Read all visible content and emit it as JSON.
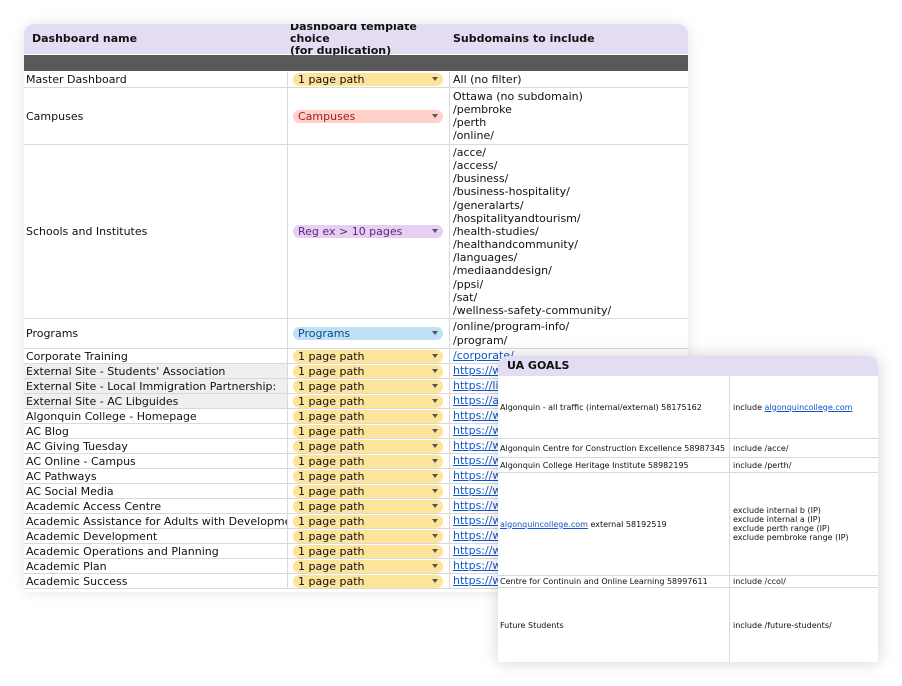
{
  "headers": {
    "name": "Dashboard name",
    "template_line1": "Dashboard template choice",
    "template_line2": "(for duplication)",
    "subdomains": "Subdomains to include"
  },
  "colors": {
    "yellow_chip": "#fde49b",
    "red_chip": "#ffcfc9",
    "purple_chip": "#e6cff2",
    "blue_chip": "#bfe1f6",
    "header_bg": "#e3dcf3",
    "link": "#1155cc"
  },
  "rows": [
    {
      "name": "Master Dashboard",
      "choice": "1 page path",
      "chip": "yellow",
      "subs": [
        "All (no filter)"
      ],
      "link": false,
      "gray": false
    },
    {
      "name": "Campuses",
      "choice": "Campuses",
      "chip": "red",
      "subs": [
        "Ottawa (no subdomain)",
        "/pembroke",
        "/perth",
        "/online/"
      ],
      "link": false,
      "gray": false
    },
    {
      "name": "Schools and Institutes",
      "choice": "Reg ex > 10 pages",
      "chip": "purple",
      "subs": [
        "/acce/",
        "/access/",
        "/business/",
        "/business-hospitality/",
        "/generalarts/",
        "/hospitalityandtourism/",
        "/health-studies/",
        "/healthandcommunity/",
        "/languages/",
        "/mediaanddesign/",
        "/ppsi/",
        "/sat/",
        "/wellness-safety-community/"
      ],
      "link": false,
      "gray": false
    },
    {
      "name": "Programs",
      "choice": "Programs",
      "chip": "blue",
      "subs": [
        "/online/program-info/",
        "/program/"
      ],
      "link": false,
      "gray": false
    },
    {
      "name": "Corporate Training",
      "choice": "1 page path",
      "chip": "yellow",
      "subs": [
        "/corporate/"
      ],
      "link": true,
      "gray": false
    },
    {
      "name": "External Site - Students' Association",
      "choice": "1 page path",
      "chip": "yellow",
      "subs": [
        "https://www.algonquinsa.com/"
      ],
      "link": true,
      "gray": true
    },
    {
      "name": "External Site - Local Immigration Partnership:",
      "choice": "1 page path",
      "chip": "yellow",
      "subs": [
        "https://lip.algonquincollege.com/"
      ],
      "link": true,
      "gray": true
    },
    {
      "name": "External Site - AC Libguides",
      "choice": "1 page path",
      "chip": "yellow",
      "subs": [
        "https://algonquincollege.libguides.com/"
      ],
      "link": true,
      "gray": true
    },
    {
      "name": "Algonquin College - Homepage",
      "choice": "1 page path",
      "chip": "yellow",
      "subs": [
        "https://www.algonquincollege.com/"
      ],
      "link": true,
      "gray": false
    },
    {
      "name": "AC Blog",
      "choice": "1 page path",
      "chip": "yellow",
      "subs": [
        "https://www.algonquincollege.com/"
      ],
      "link": true,
      "gray": false
    },
    {
      "name": "AC Giving Tuesday",
      "choice": "1 page path",
      "chip": "yellow",
      "subs": [
        "https://www.algonquincollege.com/"
      ],
      "link": true,
      "gray": false
    },
    {
      "name": "AC Online - Campus",
      "choice": "1 page path",
      "chip": "yellow",
      "subs": [
        "https://www.algonquincollege.com/"
      ],
      "link": true,
      "gray": false
    },
    {
      "name": "AC Pathways",
      "choice": "1 page path",
      "chip": "yellow",
      "subs": [
        "https://www.algonquincollege.com/"
      ],
      "link": true,
      "gray": false
    },
    {
      "name": "AC Social Media",
      "choice": "1 page path",
      "chip": "yellow",
      "subs": [
        "https://www.algonquincollege.com/"
      ],
      "link": true,
      "gray": false
    },
    {
      "name": "Academic Access Centre",
      "choice": "1 page path",
      "chip": "yellow",
      "subs": [
        "https://www.algonquincollege.com/"
      ],
      "link": true,
      "gray": false
    },
    {
      "name": "Academic Assistance for Adults with Development",
      "choice": "1 page path",
      "chip": "yellow",
      "subs": [
        "https://www.algonquincollege.com/"
      ],
      "link": true,
      "gray": false
    },
    {
      "name": "Academic Development",
      "choice": "1 page path",
      "chip": "yellow",
      "subs": [
        "https://www.algonquincollege.com/"
      ],
      "link": true,
      "gray": false
    },
    {
      "name": "Academic Operations and Planning",
      "choice": "1 page path",
      "chip": "yellow",
      "subs": [
        "https://www.algonquincollege.com/"
      ],
      "link": true,
      "gray": false
    },
    {
      "name": "Academic Plan",
      "choice": "1 page path",
      "chip": "yellow",
      "subs": [
        "https://www.algonquincollege.com/"
      ],
      "link": true,
      "gray": false
    },
    {
      "name": "Academic Success",
      "choice": "1 page path",
      "chip": "yellow",
      "subs": [
        "https://www.algonquincollege.com/"
      ],
      "link": true,
      "gray": false
    }
  ],
  "goals": {
    "title": "UA GOALS",
    "rows": [
      {
        "left": [
          {
            "t": "Algonquin - all traffic (internal/external) 58175162"
          }
        ],
        "right": [
          [
            {
              "t": "include "
            },
            {
              "t": "algonquincollege.com",
              "link": true
            }
          ]
        ]
      },
      {
        "left": [
          {
            "t": "Algonquin Centre for Construction Excellence 58987345"
          }
        ],
        "right": [
          [
            {
              "t": "include /acce/"
            }
          ]
        ]
      },
      {
        "left": [
          {
            "t": "Algonquin College Heritage Institute 58982195"
          }
        ],
        "right": [
          [
            {
              "t": "include /perth/"
            }
          ]
        ]
      },
      {
        "left": [
          {
            "t": "algonquincollege.com",
            "link": true
          },
          {
            "t": " external 58192519"
          }
        ],
        "right": [
          [
            {
              "t": "exclude internal b (IP)"
            }
          ],
          [
            {
              "t": "exclude internal a (IP)"
            }
          ],
          [
            {
              "t": "exclude perth range (IP)"
            }
          ],
          [
            {
              "t": "exclude pembroke range (IP)"
            }
          ]
        ]
      },
      {
        "left": [
          {
            "t": "Centre for Continuin and Online Learning 58997611"
          }
        ],
        "right": [
          [
            {
              "t": "include /ccol/"
            }
          ]
        ]
      },
      {
        "left": [
          {
            "t": "Future Students"
          }
        ],
        "right": [
          [
            {
              "t": "include /future-students/"
            }
          ]
        ]
      }
    ]
  }
}
